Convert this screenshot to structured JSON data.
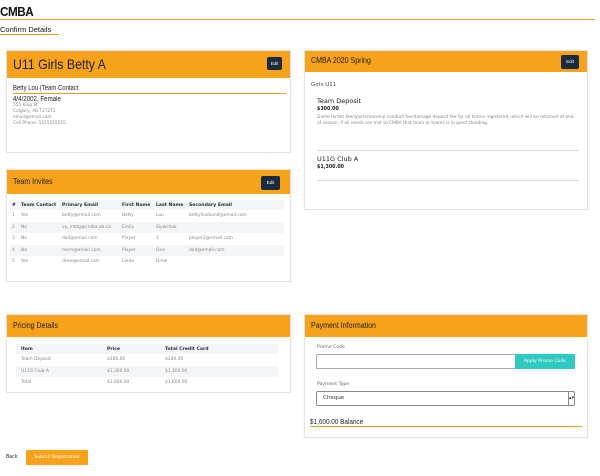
{
  "app": {
    "brand": "CMBA",
    "subtitle": "Confirm Details"
  },
  "team": {
    "title": "U11 Girls Betty A",
    "edit_label": "Edit",
    "contact_name": "Betty Lou (Team Contact",
    "contact_dob": "4/4/2002, Female",
    "address1": "555 King St",
    "address2": "Calgary, AB T2T2T2",
    "email": "email@email.com",
    "phone": "Cell Phone: 5555555555"
  },
  "season": {
    "title": "CMBA 2020 Spring",
    "edit_label": "Edit",
    "program": "Girls U11",
    "items": [
      {
        "name": "Team Deposit",
        "price": "$300.00",
        "description": "Game forfeit fee/sportsmanship conduct fee/damage deposit fee for all teams registered, which will be returned at end of season, if all needs are met to CMBA that team or teams is in good standing."
      },
      {
        "name": "U11G Club A",
        "price": "$1,300.00",
        "description": ""
      }
    ]
  },
  "invites": {
    "title": "Team Invites",
    "edit_label": "Edit",
    "headers": [
      "#",
      "Team Contact",
      "Primary Email",
      "First Name",
      "Last Name",
      "Secondary Email"
    ],
    "rows": [
      [
        "1",
        "Yes",
        "betty@email.com",
        "Betty",
        "Lou",
        "bettyhusband@email.com"
      ],
      [
        "2",
        "No",
        "vp_mktg@cmba.ab.ca",
        "Emily",
        "Slywchuk",
        ""
      ],
      [
        "3",
        "No",
        "dad@email.com",
        "Player",
        "3",
        "player3@email.com"
      ],
      [
        "4",
        "No",
        "mom@email.com",
        "Player",
        "One",
        "dad@email.com"
      ],
      [
        "5",
        "Yes",
        "drew@email.com",
        "Linda",
        "Drew",
        ""
      ]
    ]
  },
  "pricing": {
    "title": "Pricing Details",
    "headers": [
      "Item",
      "Price",
      "Total Credit Card"
    ],
    "rows": [
      [
        "Team Deposit",
        "$300.00",
        "$300.00"
      ],
      [
        "U11G Club A",
        "$1,300.00",
        "$1,300.00"
      ],
      [
        "Total",
        "$1,600.00",
        "$1,600.00"
      ]
    ]
  },
  "payment": {
    "title": "Payment Information",
    "promo_label": "Promo Code",
    "promo_value": "",
    "apply_label": "Apply Promo Code",
    "type_label": "Payment Type",
    "type_value": "Cheque",
    "balance": "$1,600.00 Balance"
  },
  "footer": {
    "back_label": "Back",
    "submit_label": "Submit Registration"
  },
  "colors": {
    "accent": "#f7a21b",
    "dark": "#1b2a3d",
    "teal": "#2ec9c0"
  }
}
